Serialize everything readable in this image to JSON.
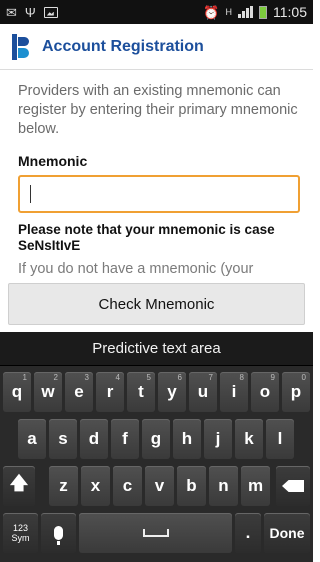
{
  "status_bar": {
    "time": "11:05"
  },
  "header": {
    "title": "Account Registration"
  },
  "content": {
    "intro": "Providers with an existing mnemonic can register by entering their primary mnemonic below.",
    "mnemonic_label": "Mnemonic",
    "mnemonic_value": "",
    "note": "Please note that your mnemonic is case SeNsItIvE",
    "clipped_text": "If you do not have a mnemonic (your"
  },
  "check_button": {
    "label": "Check Mnemonic"
  },
  "keyboard": {
    "predictive_label": "Predictive text area",
    "row1": [
      {
        "letter": "q",
        "num": "1"
      },
      {
        "letter": "w",
        "num": "2"
      },
      {
        "letter": "e",
        "num": "3"
      },
      {
        "letter": "r",
        "num": "4"
      },
      {
        "letter": "t",
        "num": "5"
      },
      {
        "letter": "y",
        "num": "6"
      },
      {
        "letter": "u",
        "num": "7"
      },
      {
        "letter": "i",
        "num": "8"
      },
      {
        "letter": "o",
        "num": "9"
      },
      {
        "letter": "p",
        "num": "0"
      }
    ],
    "row2": [
      "a",
      "s",
      "d",
      "f",
      "g",
      "h",
      "j",
      "k",
      "l"
    ],
    "row3": [
      "z",
      "x",
      "c",
      "v",
      "b",
      "n",
      "m"
    ],
    "sym_label": "123\nSym",
    "period_label": ".",
    "done_label": "Done",
    "shift_icon": "shift-arrow-icon",
    "backspace_icon": "backspace-icon",
    "mic_icon": "microphone-icon",
    "space_icon": "space-bar-icon"
  }
}
